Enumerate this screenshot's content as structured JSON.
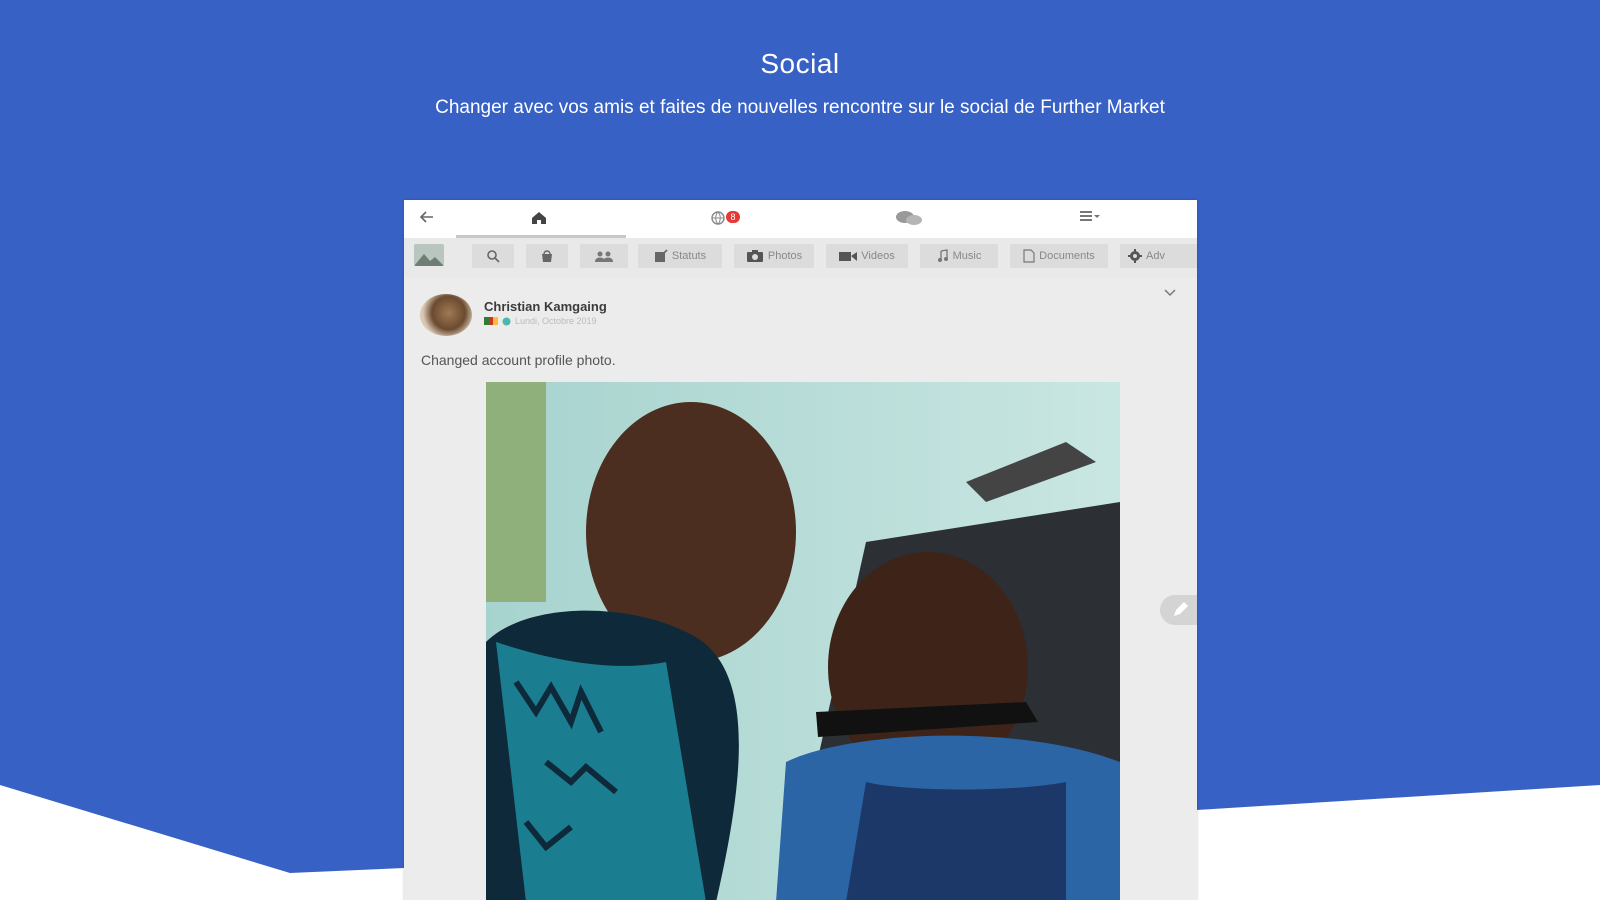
{
  "hero": {
    "title": "Social",
    "subtitle": "Changer avec vos amis et faites de nouvelles rencontre sur le social de Further Market"
  },
  "colors": {
    "brand_blue": "#3761c4",
    "badge_red": "#e53935"
  },
  "app": {
    "topbar": {
      "back_icon": "arrow-left-icon",
      "items": [
        {
          "icon": "home-icon",
          "active": true
        },
        {
          "icon": "globe-notifications-icon",
          "badge": "8"
        },
        {
          "icon": "chat-bubbles-icon"
        },
        {
          "icon": "menu-icon"
        }
      ]
    },
    "tabs": [
      {
        "icon": "search-icon",
        "label": ""
      },
      {
        "icon": "shop-icon",
        "label": ""
      },
      {
        "icon": "groups-icon",
        "label": ""
      },
      {
        "icon": "edit-status-icon",
        "label": "Statuts"
      },
      {
        "icon": "camera-icon",
        "label": "Photos"
      },
      {
        "icon": "video-icon",
        "label": "Videos"
      },
      {
        "icon": "music-note-icon",
        "label": "Music"
      },
      {
        "icon": "document-icon",
        "label": "Documents"
      },
      {
        "icon": "gear-icon",
        "label": "Adv"
      }
    ],
    "post": {
      "author": "Christian Kamgaing",
      "date": "Lundi, Octobre 2019",
      "text": "Changed account profile photo.",
      "flag_colors": [
        "#2e7d32",
        "#d32f2f",
        "#fbc02d"
      ]
    }
  }
}
